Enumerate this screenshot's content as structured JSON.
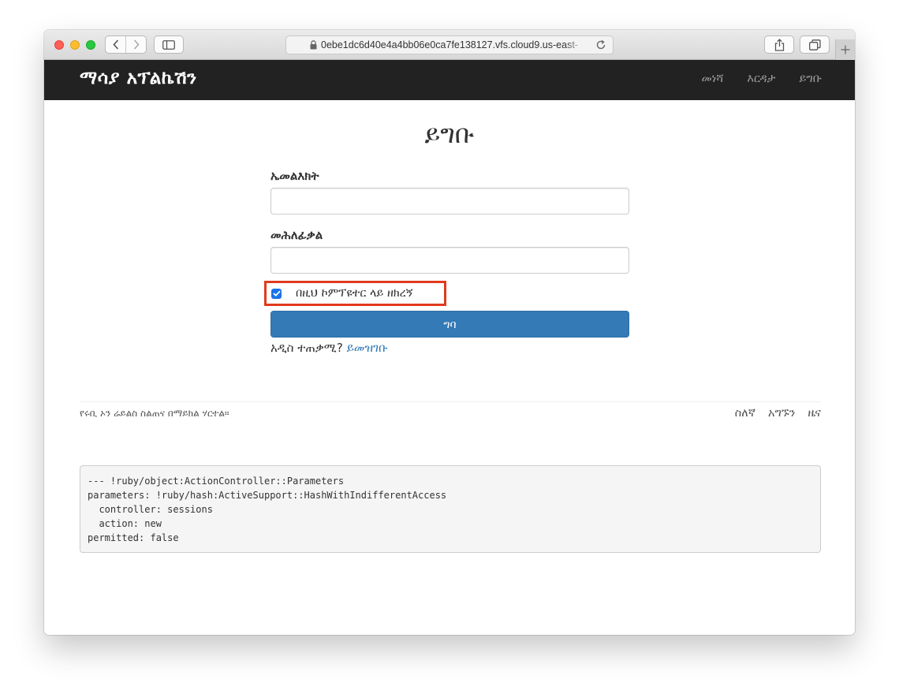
{
  "browser": {
    "url": "0ebe1dc6d40e4a4bb06e0ca7fe138127.vfs.cloud9.us-east-"
  },
  "header": {
    "brand": "ማሳያ አፕልኬሽን",
    "nav": [
      "መነሻ",
      "እርዳታ",
      "ይግቡ"
    ]
  },
  "page": {
    "title": "ይግቡ"
  },
  "form": {
    "email_label": "ኤመልእክት",
    "email_value": "",
    "password_label": "መሕለፊቃል",
    "password_value": "",
    "remember_label": "በዚህ ኮምፕዩተር ላይ ዘክረኝ",
    "remember_checked": true,
    "submit_label": "ግባ",
    "signup_prompt": "አዲስ ተጠቃሚ?",
    "signup_link": "ይመዝገቡ"
  },
  "footer": {
    "text": "የሩቢ ኦን ሬይልስ ስልጠና በማይክል ሃርተል።",
    "links": [
      "ስለኛ",
      "አግኙን",
      "ዜና"
    ]
  },
  "debug": {
    "lines": [
      "--- !ruby/object:ActionController::Parameters",
      "parameters: !ruby/hash:ActiveSupport::HashWithIndifferentAccess",
      "  controller: sessions",
      "  action: new",
      "permitted: false"
    ]
  },
  "colors": {
    "navbar": "#222222",
    "primary": "#337ab7",
    "highlight": "#e13a1e"
  }
}
